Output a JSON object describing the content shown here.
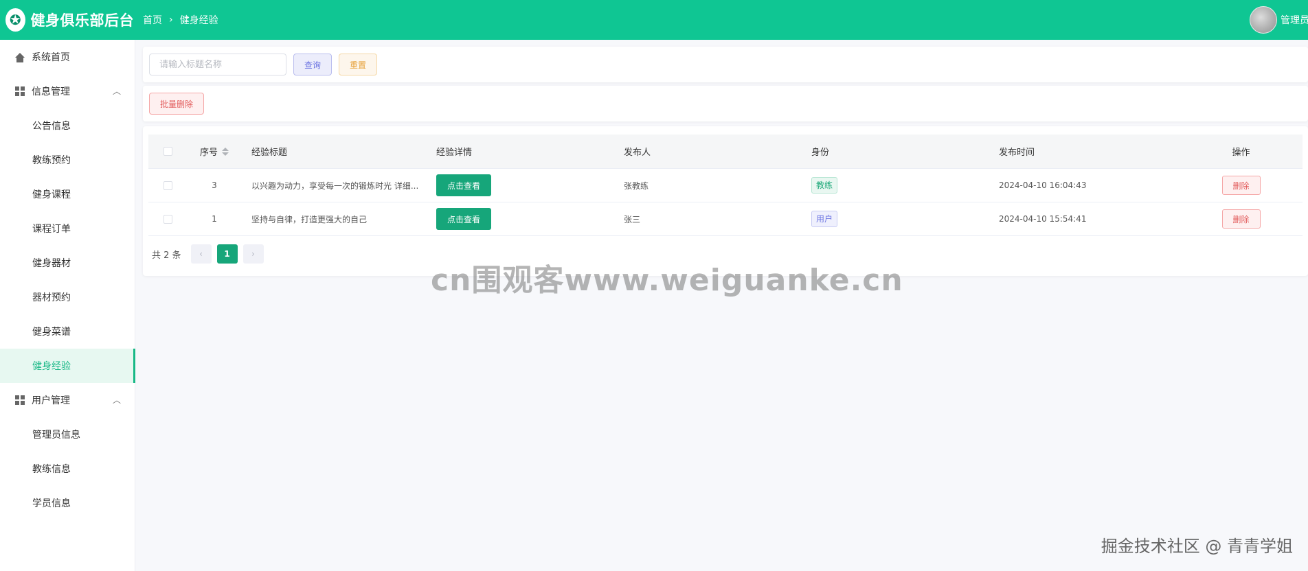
{
  "app": {
    "logo_glyph": "✪",
    "title": "健身俱乐部后台"
  },
  "breadcrumb": {
    "home": "首页",
    "separator": "›",
    "current": "健身经验"
  },
  "user": {
    "name": "管理员"
  },
  "sidebar": {
    "home": "系统首页",
    "groups": [
      {
        "label": "信息管理",
        "items": [
          "公告信息",
          "教练预约",
          "健身课程",
          "课程订单",
          "健身器材",
          "器材预约",
          "健身菜谱",
          "健身经验"
        ]
      },
      {
        "label": "用户管理",
        "items": [
          "管理员信息",
          "教练信息",
          "学员信息"
        ]
      }
    ],
    "active": "健身经验"
  },
  "search": {
    "placeholder": "请输入标题名称",
    "query": "查询",
    "reset": "重置"
  },
  "ops": {
    "batch_delete": "批量删除"
  },
  "table": {
    "columns": [
      "序号",
      "经验标题",
      "经验详情",
      "发布人",
      "身份",
      "发布时间",
      "操作"
    ],
    "rows": [
      {
        "no": "3",
        "title": "以兴趣为动力，享受每一次的锻炼时光 详细...",
        "detail": "点击查看",
        "publisher": "张教练",
        "role": "教练",
        "time": "2024-04-10 16:04:43",
        "action": "删除"
      },
      {
        "no": "1",
        "title": "坚持与自律，打造更强大的自己",
        "detail": "点击查看",
        "publisher": "张三",
        "role": "用户",
        "time": "2024-04-10 15:54:41",
        "action": "删除"
      }
    ]
  },
  "pagination": {
    "total": "共 2 条",
    "current": "1",
    "prev": "‹",
    "next": "›"
  },
  "watermark": {
    "center": "cn围观客www.weiguanke.cn",
    "corner": "掘金技术社区 @ 青青学姐"
  },
  "colors": {
    "header": "#0fc693",
    "primary": "#16a67a",
    "danger": "#e25c5c",
    "info": "#6b73e2",
    "warning": "#e6a23c"
  }
}
